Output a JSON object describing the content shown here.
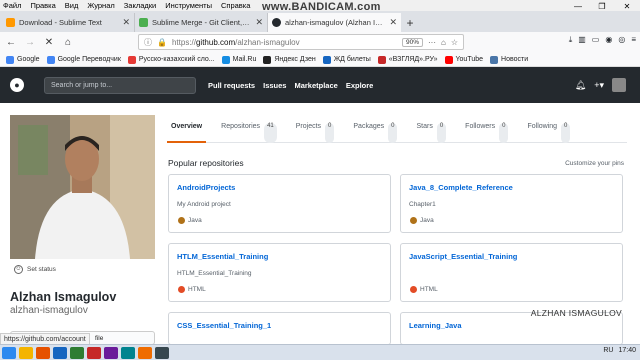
{
  "window": {
    "menu": [
      "Файл",
      "Правка",
      "Вид",
      "Журнал",
      "Закладки",
      "Инструменты",
      "Справка"
    ],
    "watermark": "www.BANDICAM.com",
    "controls": [
      "—",
      "❐",
      "✕"
    ]
  },
  "tabs": [
    {
      "title": "Download - Sublime Text",
      "color": "#ff9800"
    },
    {
      "title": "Sublime Merge - Git Client, do",
      "color": "#4caf50"
    },
    {
      "title": "alzhan-ismagulov (Alzhan Isma",
      "color": "#24292e"
    }
  ],
  "url": {
    "prefix": "https://",
    "host": "github.com",
    "path": "/alzhan-ismagulov",
    "zoom": "90%"
  },
  "bookmarks": [
    {
      "label": "Google",
      "color": "#4285f4"
    },
    {
      "label": "Google Переводчик",
      "color": "#4285f4"
    },
    {
      "label": "Русско-казахский сло...",
      "color": "#e53935"
    },
    {
      "label": "Mail.Ru",
      "color": "#168de2"
    },
    {
      "label": "Яндекс Дзен",
      "color": "#222222"
    },
    {
      "label": "ЖД билеты",
      "color": "#1565c0"
    },
    {
      "label": "«ВЗГЛЯД».РУ»",
      "color": "#c62828"
    },
    {
      "label": "YouTube",
      "color": "#ff0000"
    },
    {
      "label": "Новости",
      "color": "#4a76a8"
    }
  ],
  "github": {
    "search_placeholder": "Search or jump to...",
    "nav": [
      "Pull requests",
      "Issues",
      "Marketplace",
      "Explore"
    ]
  },
  "profile": {
    "name": "Alzhan Ismagulov",
    "login": "alzhan-ismagulov",
    "status": "Set status",
    "edit": "file"
  },
  "profile_tabs": [
    {
      "label": "Overview",
      "count": ""
    },
    {
      "label": "Repositories",
      "count": "41"
    },
    {
      "label": "Projects",
      "count": "0"
    },
    {
      "label": "Packages",
      "count": "0"
    },
    {
      "label": "Stars",
      "count": "0"
    },
    {
      "label": "Followers",
      "count": "0"
    },
    {
      "label": "Following",
      "count": "0"
    }
  ],
  "popular": {
    "title": "Popular repositories",
    "customize": "Customize your pins",
    "repos": [
      {
        "name": "AndroidProjects",
        "desc": "My Android project",
        "lang": "Java",
        "lang_color": "#b07219"
      },
      {
        "name": "Java_8_Complete_Reference",
        "desc": "Chapter1",
        "lang": "Java",
        "lang_color": "#b07219"
      },
      {
        "name": "HTLM_Essential_Training",
        "desc": "HTLM_Essential_Training",
        "lang": "HTML",
        "lang_color": "#e34c26"
      },
      {
        "name": "JavaScript_Essential_Training",
        "desc": "",
        "lang": "HTML",
        "lang_color": "#e34c26"
      },
      {
        "name": "CSS_Essential_Training_1",
        "desc": "",
        "lang": "",
        "lang_color": ""
      },
      {
        "name": "Learning_Java",
        "desc": "",
        "lang": "",
        "lang_color": ""
      }
    ]
  },
  "hover_url": "https://github.com/account",
  "caption": "ALZHAN ISMAGULOV",
  "taskbar": {
    "time": "17:40",
    "lang": "RU"
  }
}
